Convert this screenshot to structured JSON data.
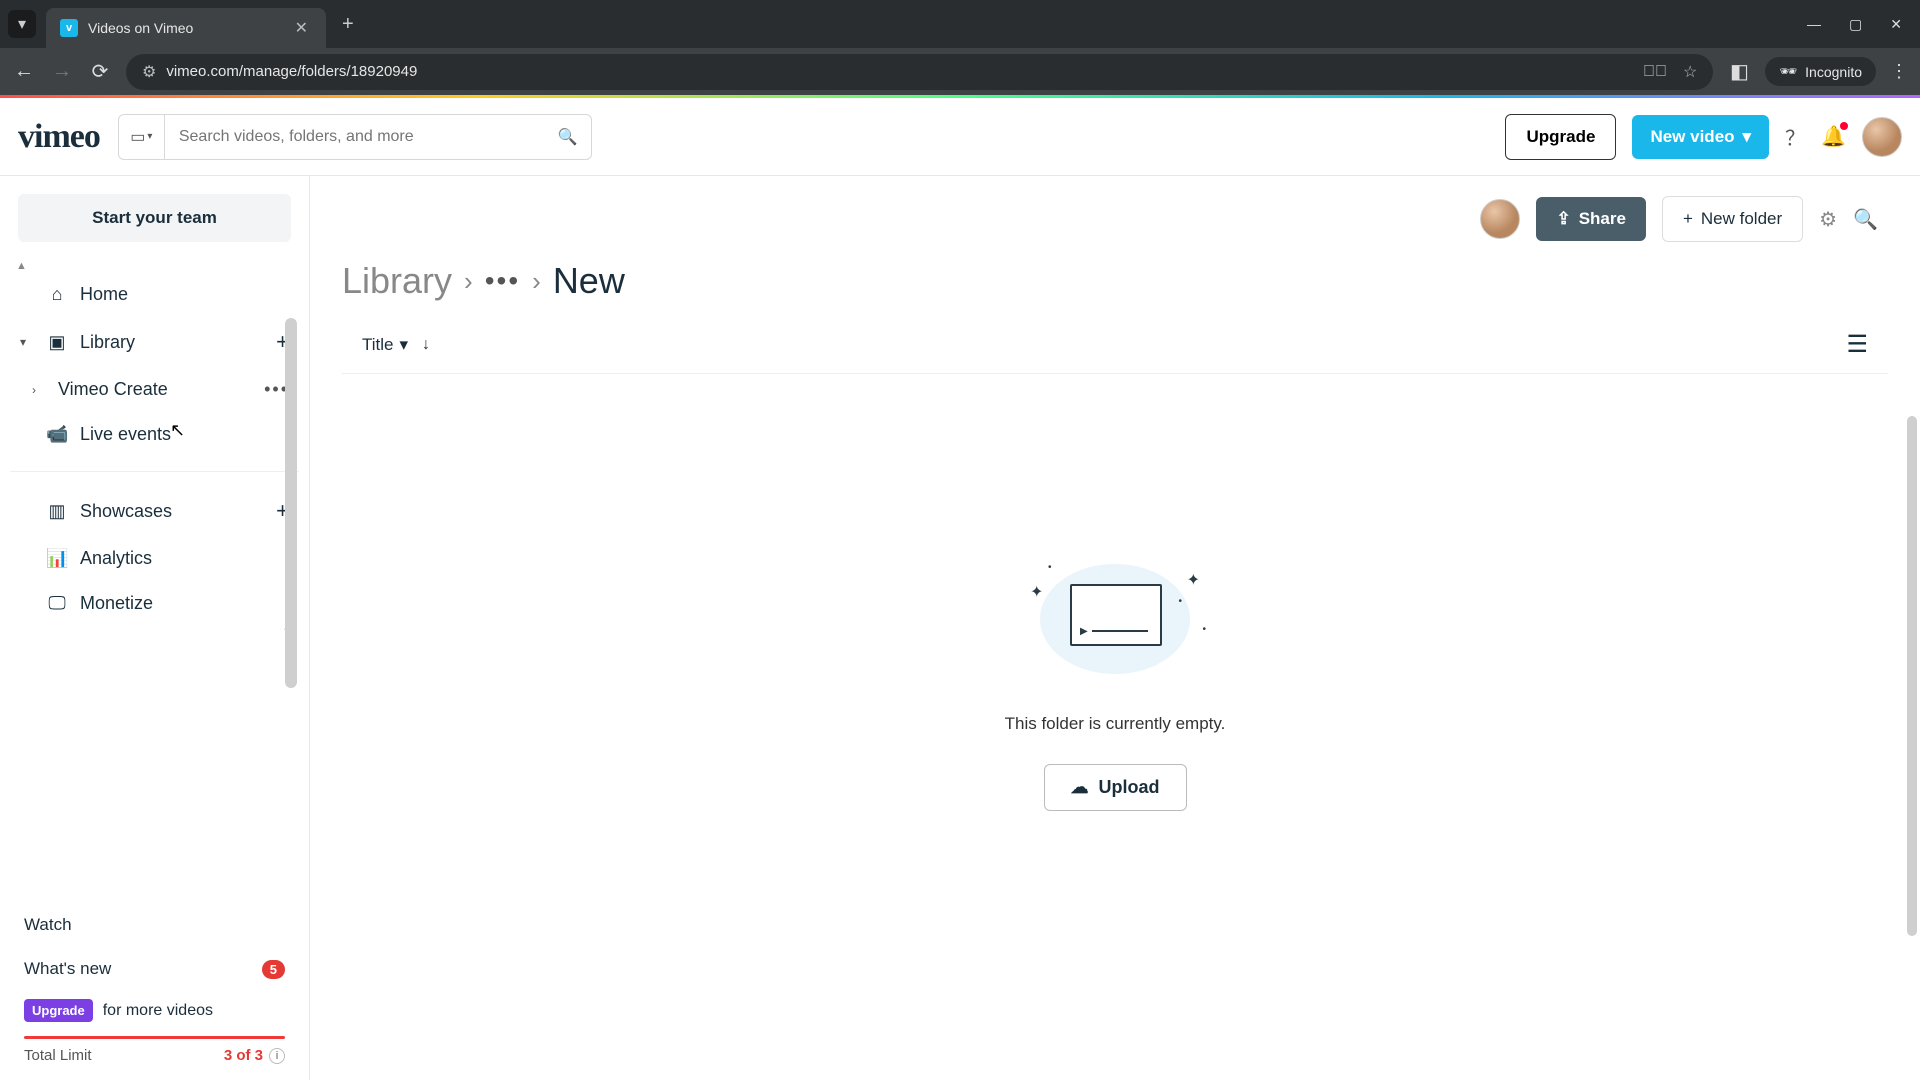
{
  "browser": {
    "tab_title": "Videos on Vimeo",
    "url": "vimeo.com/manage/folders/18920949",
    "incognito_label": "Incognito"
  },
  "header": {
    "logo": "vimeo",
    "search_placeholder": "Search videos, folders, and more",
    "upgrade": "Upgrade",
    "new_video": "New video"
  },
  "sidebar": {
    "team_btn": "Start your team",
    "items": {
      "home": "Home",
      "library": "Library",
      "vimeo_create": "Vimeo Create",
      "live_events": "Live events",
      "showcases": "Showcases",
      "analytics": "Analytics",
      "monetize": "Monetize",
      "watch": "Watch",
      "whats_new": "What's new",
      "whats_new_badge": "5"
    },
    "upgrade_pill": "Upgrade",
    "upgrade_text": "for more videos",
    "limit_label": "Total Limit",
    "limit_count": "3 of 3"
  },
  "toolbar": {
    "share": "Share",
    "new_folder": "New folder"
  },
  "breadcrumb": {
    "root": "Library",
    "current": "New"
  },
  "sort": {
    "label": "Title"
  },
  "empty": {
    "text": "This folder is currently empty.",
    "upload": "Upload"
  }
}
